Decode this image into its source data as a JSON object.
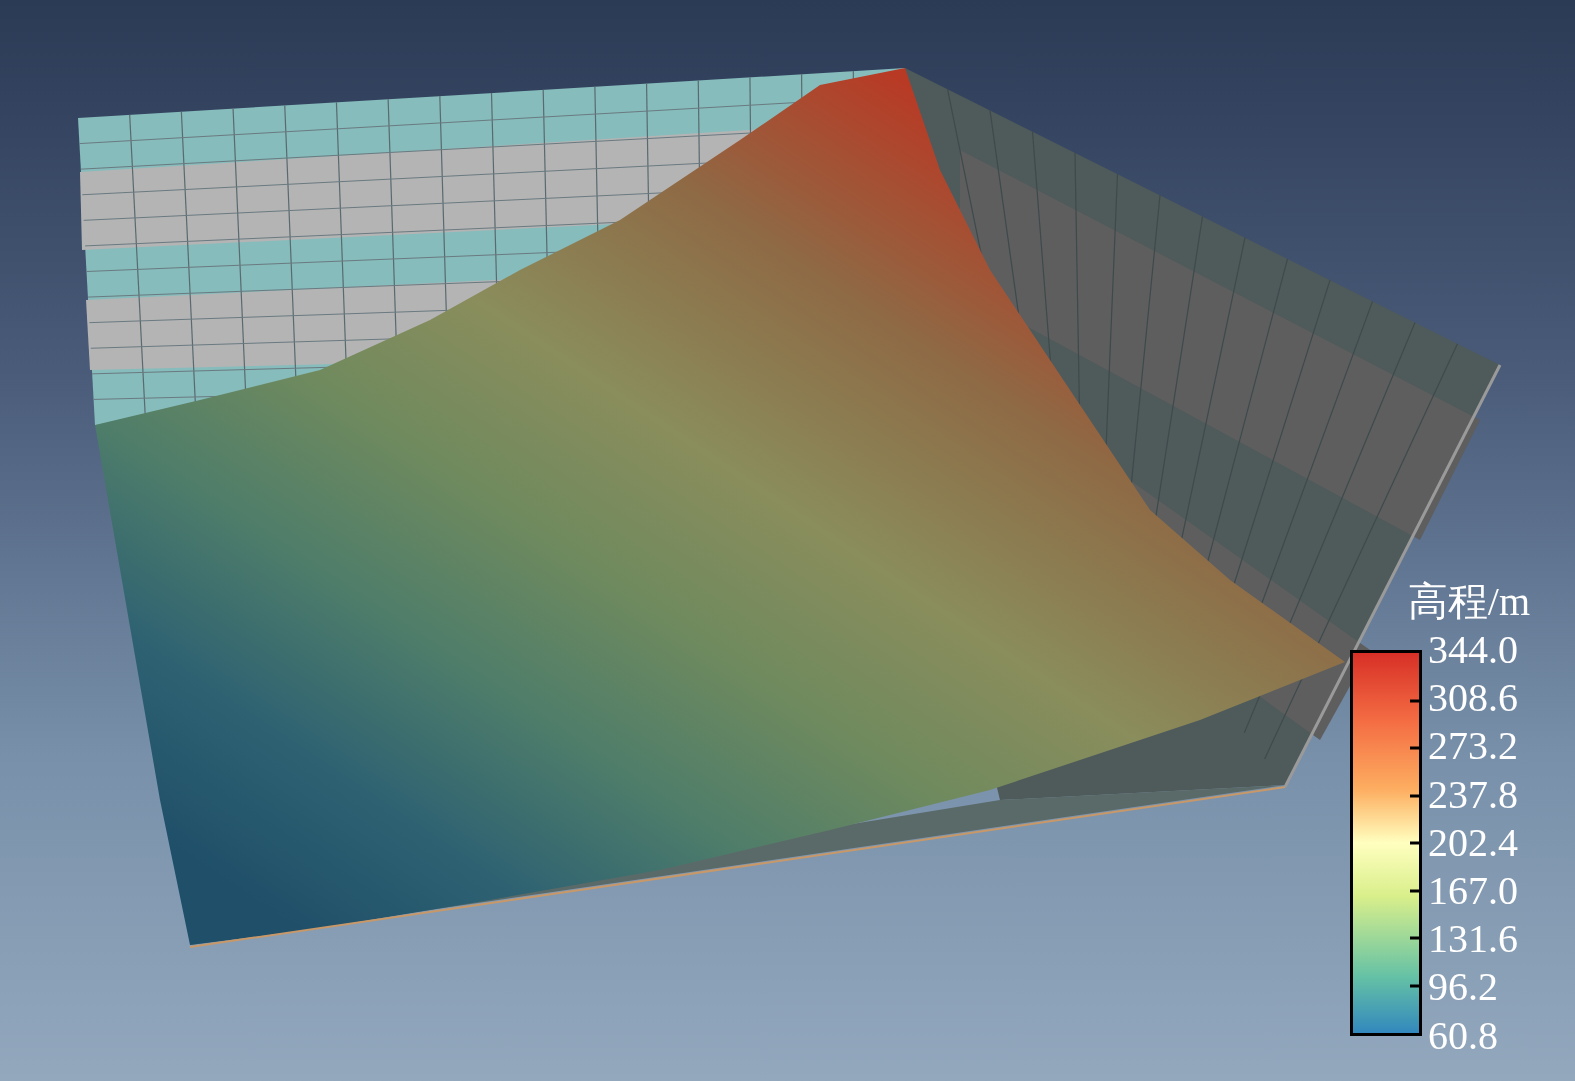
{
  "legend": {
    "title": "高程/m",
    "labels": [
      "344.0",
      "308.6",
      "273.2",
      "237.8",
      "202.4",
      "167.0",
      "131.6",
      "96.2",
      "60.8"
    ]
  }
}
